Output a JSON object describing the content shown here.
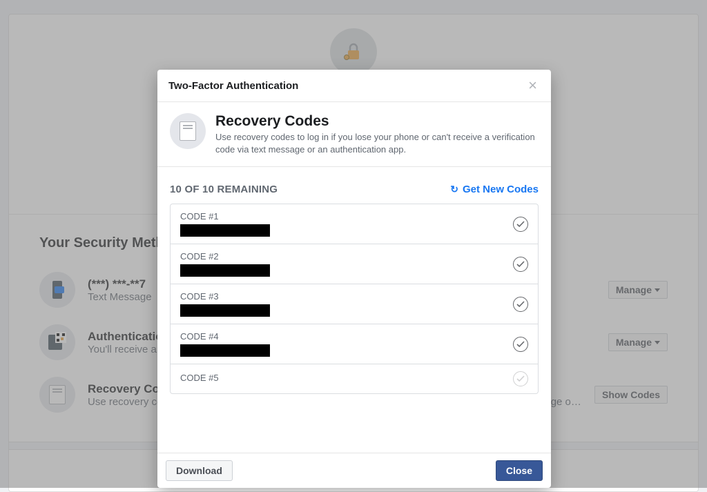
{
  "background": {
    "section_title": "Your Security Methods",
    "methods": [
      {
        "title": "(***) ***-**7",
        "subtitle": "Text Message",
        "action": "Manage"
      },
      {
        "title": "Authentication",
        "subtitle": "You'll receive a",
        "action": "Manage"
      },
      {
        "title": "Recovery Codes",
        "subtitle": "Use recovery codes to log in if you lose your phone or can't receive a verification code via text message or an authentication",
        "action": "Show Codes"
      }
    ]
  },
  "modal": {
    "title": "Two-Factor Authentication",
    "intro_heading": "Recovery Codes",
    "intro_body": "Use recovery codes to log in if you lose your phone or can't receive a verification code via text message or an authentication app.",
    "remaining_label": "10 OF 10 REMAINING",
    "get_new_label": "Get New Codes",
    "codes": [
      {
        "label": "CODE #1",
        "redacted": true
      },
      {
        "label": "CODE #2",
        "redacted": true
      },
      {
        "label": "CODE #3",
        "redacted": true
      },
      {
        "label": "CODE #4",
        "redacted": true
      },
      {
        "label": "CODE #5",
        "redacted": true
      }
    ],
    "download_label": "Download",
    "close_label": "Close"
  }
}
